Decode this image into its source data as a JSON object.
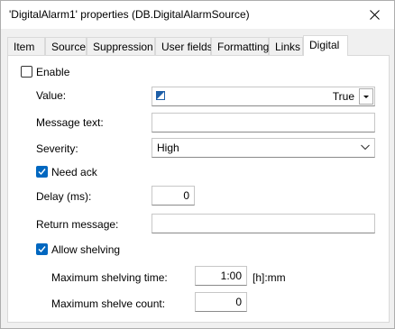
{
  "window": {
    "title": "'DigitalAlarm1' properties (DB.DigitalAlarmSource)"
  },
  "tabs": [
    {
      "label": "Item"
    },
    {
      "label": "Source"
    },
    {
      "label": "Suppression"
    },
    {
      "label": "User fields"
    },
    {
      "label": "Formatting"
    },
    {
      "label": "Links"
    },
    {
      "label": "Digital",
      "active": true
    }
  ],
  "form": {
    "enable": {
      "label": "Enable",
      "checked": false
    },
    "value": {
      "label": "Value:",
      "selected": "True"
    },
    "message_text": {
      "label": "Message text:",
      "value": ""
    },
    "severity": {
      "label": "Severity:",
      "selected": "High"
    },
    "need_ack": {
      "label": "Need ack",
      "checked": true
    },
    "delay": {
      "label": "Delay (ms):",
      "value": "0"
    },
    "return_message": {
      "label": "Return message:",
      "value": ""
    },
    "allow_shelving": {
      "label": "Allow shelving",
      "checked": true
    },
    "max_shelving_time": {
      "label": "Maximum shelving time:",
      "value": "1:00",
      "unit": "[h]:mm"
    },
    "max_shelve_count": {
      "label": "Maximum shelve count:",
      "value": "0"
    }
  },
  "colors": {
    "accent": "#0067c0",
    "panel": "#ffffff",
    "chrome": "#f0f0f0"
  }
}
